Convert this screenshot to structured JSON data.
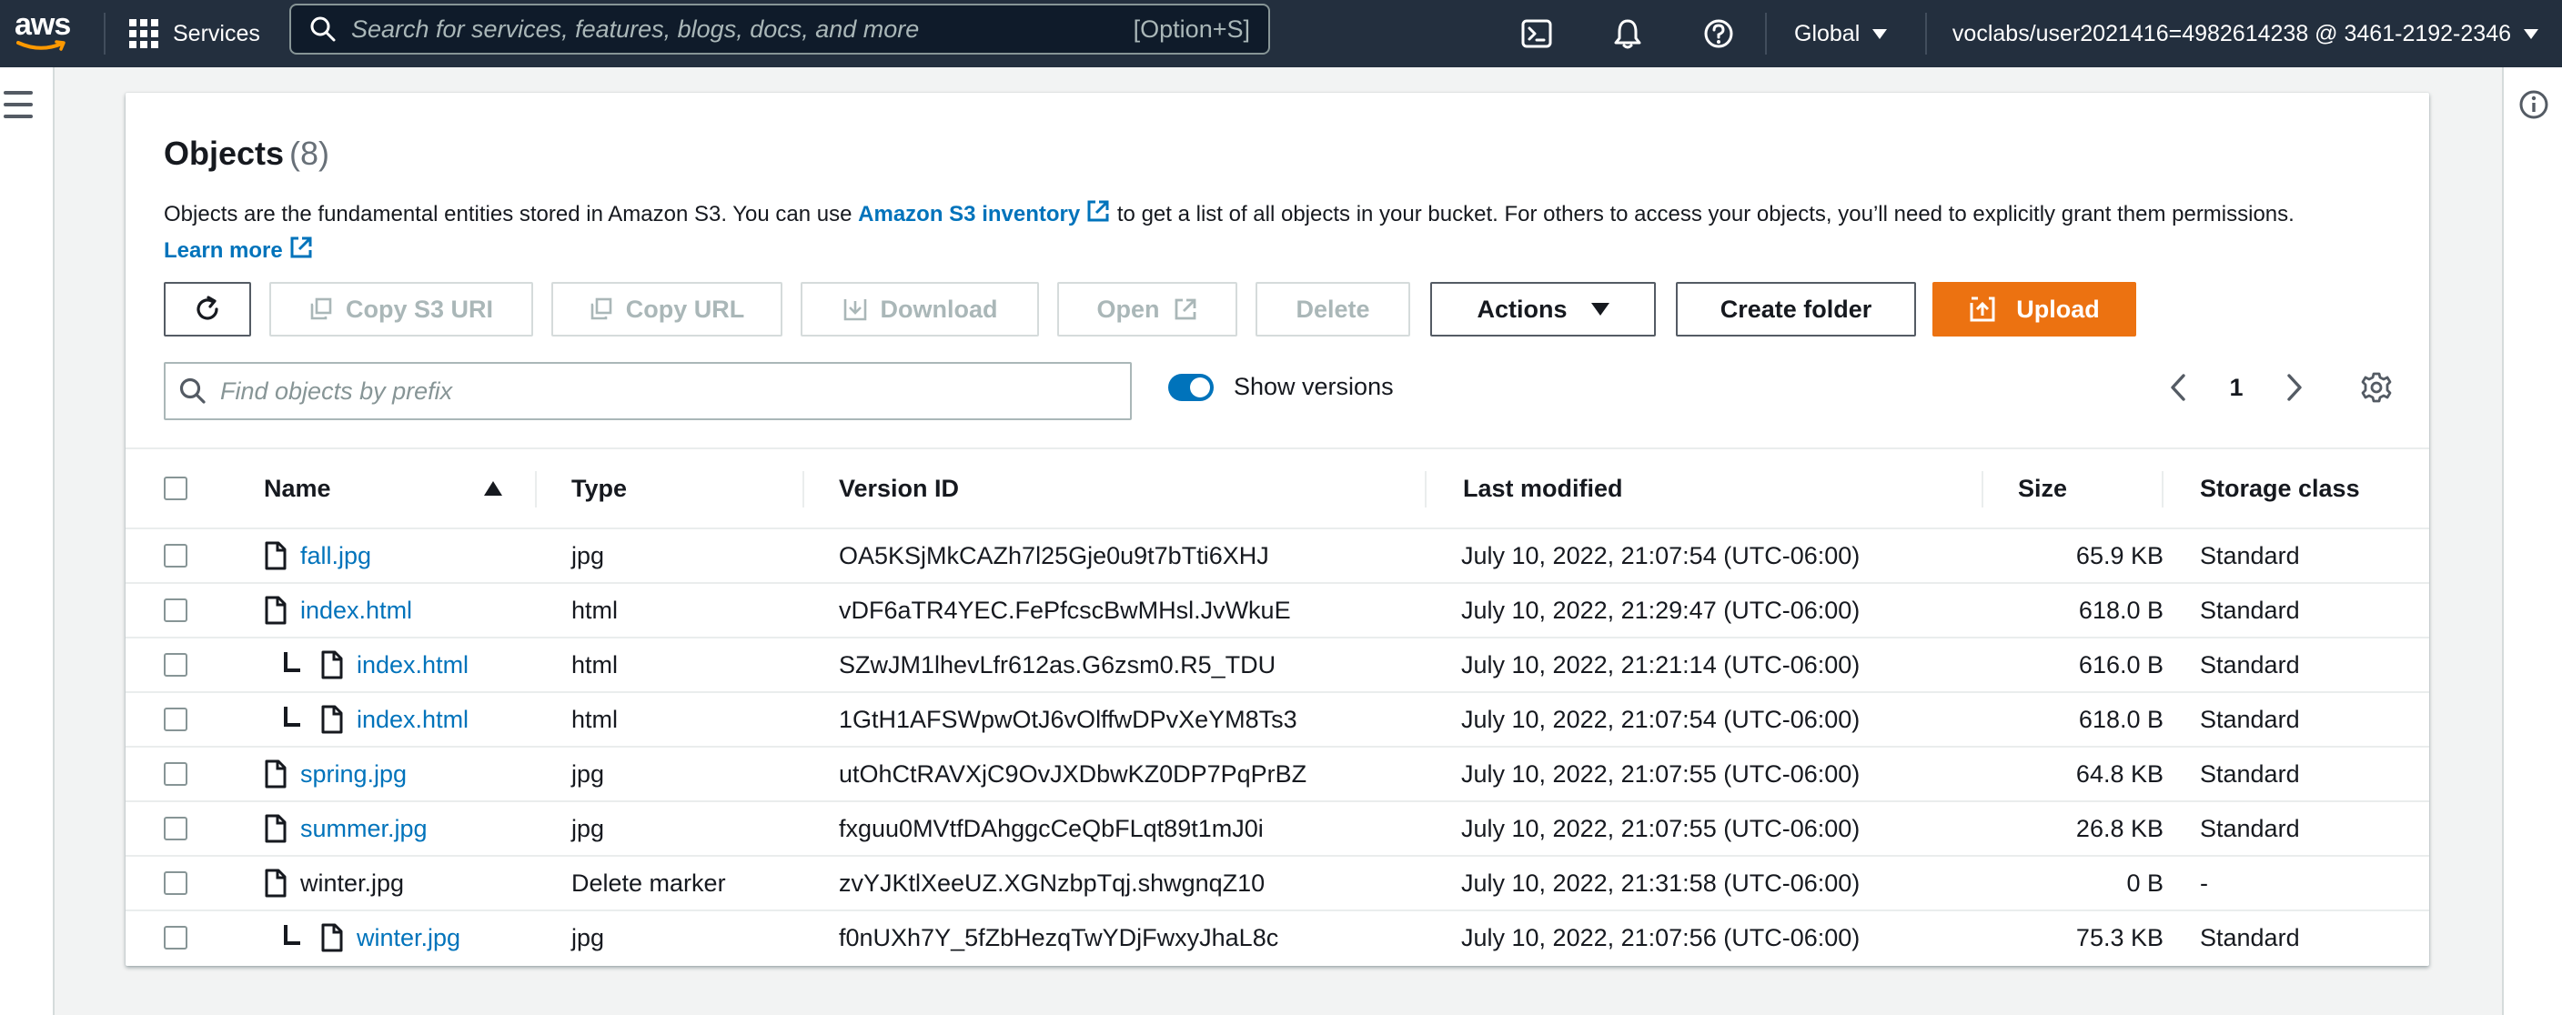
{
  "nav": {
    "logo": "aws",
    "services_label": "Services",
    "search_placeholder": "Search for services, features, blogs, docs, and more",
    "search_shortcut": "[Option+S]",
    "region_label": "Global",
    "account_label": "voclabs/user2021416=4982614238 @ 3461-2192-2346",
    "icons": [
      "cloudshell-icon",
      "bell-icon",
      "help-icon"
    ]
  },
  "objects": {
    "title": "Objects",
    "count": "(8)",
    "description": {
      "before_link": "Objects are the fundamental entities stored in Amazon S3. You can use ",
      "inventory_link": "Amazon S3 inventory",
      "after_link": " to get a list of all objects in your bucket. For others to access your objects, you’ll need to explicitly grant them permissions.",
      "learn_more": "Learn more"
    },
    "toolbar": {
      "copy_s3_uri": "Copy S3 URI",
      "copy_url": "Copy URL",
      "download": "Download",
      "open": "Open",
      "delete": "Delete",
      "actions": "Actions",
      "create_folder": "Create folder",
      "upload": "Upload"
    },
    "filter_placeholder": "Find objects by prefix",
    "show_versions_label": "Show versions",
    "show_versions_on": true,
    "page": "1",
    "columns": {
      "name": "Name",
      "type": "Type",
      "version_id": "Version ID",
      "last_modified": "Last modified",
      "size": "Size",
      "storage_class": "Storage class"
    },
    "rows": [
      {
        "name": "fall.jpg",
        "is_link": true,
        "nested": false,
        "type": "jpg",
        "version_id": "OA5KSjMkCAZh7l25Gje0u9t7bTti6XHJ",
        "last_modified": "July 10, 2022, 21:07:54 (UTC-06:00)",
        "size": "65.9 KB",
        "storage_class": "Standard"
      },
      {
        "name": "index.html",
        "is_link": true,
        "nested": false,
        "type": "html",
        "version_id": "vDF6aTR4YEC.FePfcscBwMHsl.JvWkuE",
        "last_modified": "July 10, 2022, 21:29:47 (UTC-06:00)",
        "size": "618.0 B",
        "storage_class": "Standard"
      },
      {
        "name": "index.html",
        "is_link": true,
        "nested": true,
        "type": "html",
        "version_id": "SZwJM1lhevLfr612as.G6zsm0.R5_TDU",
        "last_modified": "July 10, 2022, 21:21:14 (UTC-06:00)",
        "size": "616.0 B",
        "storage_class": "Standard"
      },
      {
        "name": "index.html",
        "is_link": true,
        "nested": true,
        "type": "html",
        "version_id": "1GtH1AFSWpwOtJ6vOlffwDPvXeYM8Ts3",
        "last_modified": "July 10, 2022, 21:07:54 (UTC-06:00)",
        "size": "618.0 B",
        "storage_class": "Standard"
      },
      {
        "name": "spring.jpg",
        "is_link": true,
        "nested": false,
        "type": "jpg",
        "version_id": "utOhCtRAVXjC9OvJXDbwKZ0DP7PqPrBZ",
        "last_modified": "July 10, 2022, 21:07:55 (UTC-06:00)",
        "size": "64.8 KB",
        "storage_class": "Standard"
      },
      {
        "name": "summer.jpg",
        "is_link": true,
        "nested": false,
        "type": "jpg",
        "version_id": "fxguu0MVtfDAhggcCeQbFLqt89t1mJ0i",
        "last_modified": "July 10, 2022, 21:07:55 (UTC-06:00)",
        "size": "26.8 KB",
        "storage_class": "Standard"
      },
      {
        "name": "winter.jpg",
        "is_link": false,
        "nested": false,
        "type": "Delete marker",
        "version_id": "zvYJKtlXeeUZ.XGNzbpTqj.shwgnqZ10",
        "last_modified": "July 10, 2022, 21:31:58 (UTC-06:00)",
        "size": "0 B",
        "storage_class": "-"
      },
      {
        "name": "winter.jpg",
        "is_link": true,
        "nested": true,
        "type": "jpg",
        "version_id": "f0nUXh7Y_5fZbHezqTwYDjFwxyJhaL8c",
        "last_modified": "July 10, 2022, 21:07:56 (UTC-06:00)",
        "size": "75.3 KB",
        "storage_class": "Standard"
      }
    ]
  },
  "colors": {
    "nav_bg": "#232f3e",
    "link": "#0073bb",
    "primary": "#ec7211",
    "toggle_on": "#0073bb"
  }
}
